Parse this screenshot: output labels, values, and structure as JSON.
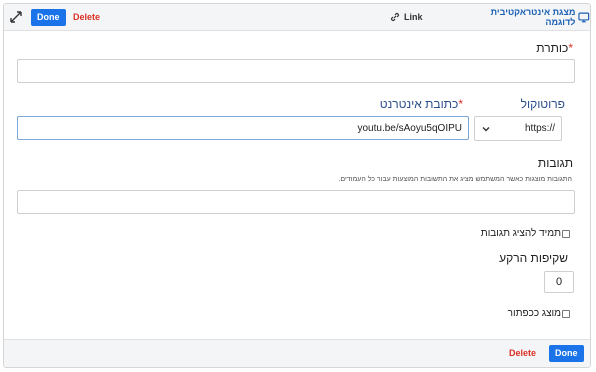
{
  "toolbar": {
    "done_label": "Done",
    "delete_label": "Delete",
    "link_label": "Link",
    "preview_label": "מצגת אינטראקטיבית לדוגמה"
  },
  "form": {
    "title_label": "כותרת",
    "title_value": "",
    "protocol_label": "פרוטוקול",
    "protocol_value": "https://",
    "url_label": "כתובת אינטרנט",
    "url_value": "youtu.be/sAoyu5qOIPU",
    "responses_label": "תגובות",
    "responses_hint": "התגובות מוצגות כאשר המשתמש מציג את התשובות המוצעות עבור כל העמודים.",
    "responses_value": "",
    "always_show_label": "תמיד להציג תגובות",
    "opacity_label": "שקיפות הרקע",
    "opacity_value": "0",
    "show_as_button_label": "מוצג ככפתור",
    "required_mark": "*"
  },
  "footer": {
    "done_label": "Done",
    "delete_label": "Delete"
  },
  "colors": {
    "accent": "#1a73e8",
    "danger": "#d93025",
    "label_blue": "#2a4f8a"
  },
  "icons": {
    "expand": "expand-arrows-icon",
    "link": "link-icon",
    "preview": "monitor-icon",
    "dropdown": "chevron-down-icon"
  }
}
